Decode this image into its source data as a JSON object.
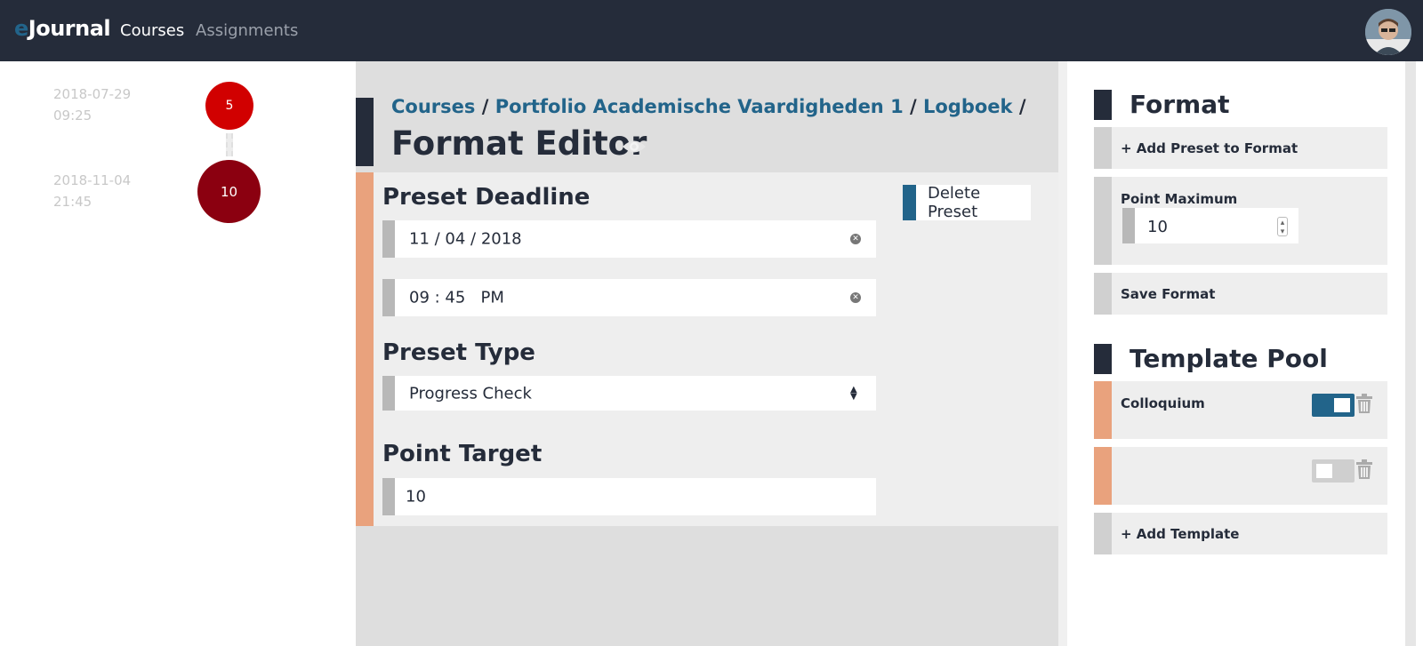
{
  "nav": {
    "brand_e": "e",
    "brand_rest": "Journal",
    "links": [
      "Courses",
      "Assignments"
    ]
  },
  "timeline": [
    {
      "date": "2018-07-29",
      "time": "09:25",
      "points": "5"
    },
    {
      "date": "2018-11-04",
      "time": "21:45",
      "points": "10"
    }
  ],
  "breadcrumb": {
    "items": [
      "Courses",
      "Portfolio Academische Vaardigheden 1",
      "Logboek"
    ],
    "separator": "/"
  },
  "page_title": "Format Editor",
  "editor": {
    "deadline_title": "Preset Deadline",
    "date_value": "11 / 04 / 2018",
    "time_value": "09 : 45   PM",
    "type_title": "Preset Type",
    "type_value": "Progress Check",
    "target_title": "Point Target",
    "target_value": "10",
    "delete_label": "Delete Preset"
  },
  "format_panel": {
    "title": "Format",
    "add_preset_label": "+ Add Preset to Format",
    "point_max_label": "Point Maximum",
    "point_max_value": "10",
    "save_label": "Save Format"
  },
  "template_pool": {
    "title": "Template Pool",
    "templates": [
      {
        "name": "Colloquium",
        "enabled": true
      },
      {
        "name": "",
        "enabled": false
      }
    ],
    "add_label": "+ Add Template"
  },
  "colors": {
    "navy": "#252c3a",
    "accent_blue": "#22648a",
    "orange": "#e9a27d",
    "node_red": "#d10000",
    "node_dark_red": "#8b0010"
  }
}
